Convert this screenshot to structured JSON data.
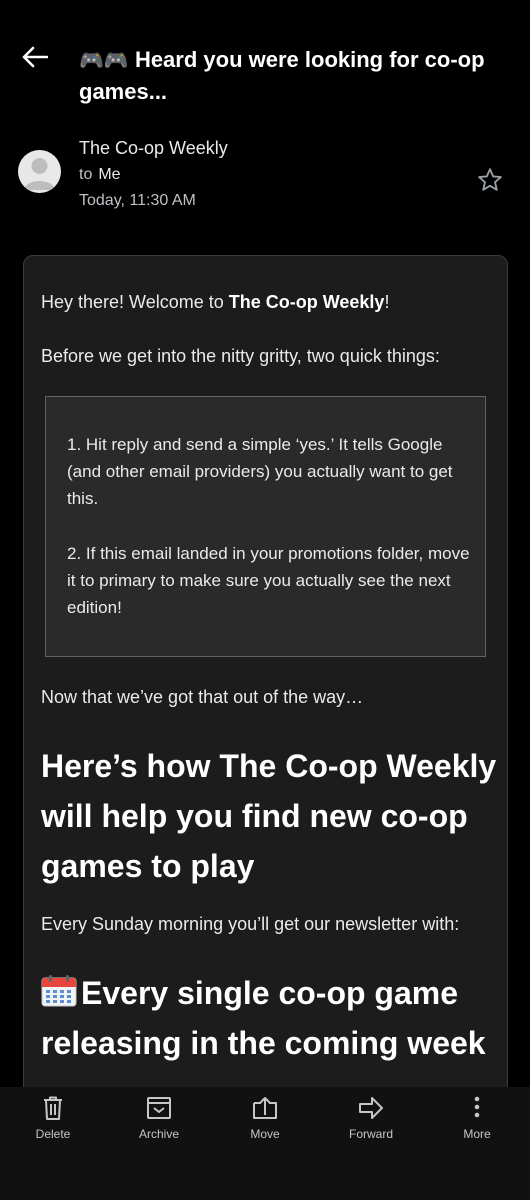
{
  "header": {
    "subject_emoji": "🎮🎮",
    "subject": "Heard you were looking for co-op games..."
  },
  "sender": {
    "name": "The Co-op Weekly",
    "to_prefix": "to",
    "to": "Me",
    "date": "Today, 11:30 AM"
  },
  "body": {
    "greeting_prefix": "Hey there! Welcome to ",
    "greeting_brand": "The Co-op Weekly",
    "greeting_suffix": "!",
    "intro": "Before we get into the nitty gritty, two quick things:",
    "tip1": "1. Hit reply and send a simple ‘yes.’ It tells Google (and other email providers) you actually want to get this.",
    "tip2": "2. If this email landed in your promotions folder, move it to primary to make sure you actually see the next edition!",
    "transition": "Now that we’ve got that out of the way…",
    "heading1": "Here’s how The Co-op Weekly will help you find new co-op games to play",
    "newsletter_line": "Every Sunday morning you’ll get our newsletter with:",
    "heading2": "Every single co-op game releasing in the coming week"
  },
  "bottom_bar": {
    "items": [
      {
        "label": "Delete",
        "icon": "trash-icon"
      },
      {
        "label": "Archive",
        "icon": "archive-icon"
      },
      {
        "label": "Move",
        "icon": "move-icon"
      },
      {
        "label": "Forward",
        "icon": "forward-icon"
      },
      {
        "label": "More",
        "icon": "more-vertical-icon"
      }
    ]
  }
}
